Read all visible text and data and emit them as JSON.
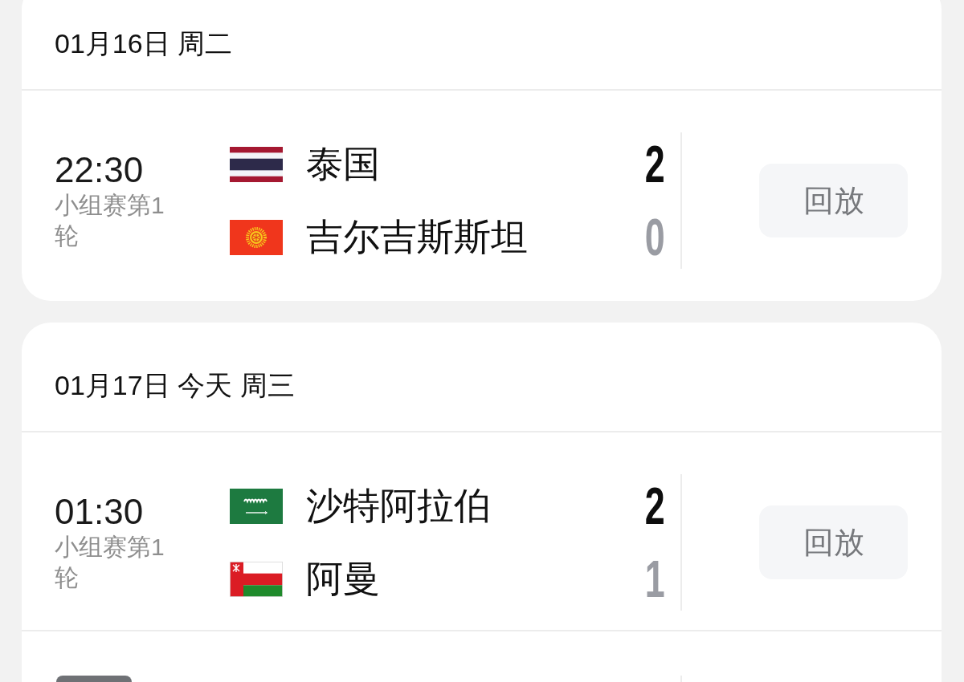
{
  "days": [
    {
      "date": "01月16日 周二",
      "matches": [
        {
          "kind": "result",
          "time": "22:30",
          "round": "小组赛第1轮",
          "teams": [
            {
              "kind": "thailand",
              "name": "泰国",
              "score": "2",
              "winner": true
            },
            {
              "kind": "kyrgyzstan",
              "name": "吉尔吉斯斯坦",
              "score": "0",
              "winner": false
            }
          ],
          "action": "回放"
        }
      ]
    },
    {
      "date": "01月17日 今天 周三",
      "matches": [
        {
          "kind": "result",
          "time": "01:30",
          "round": "小组赛第1轮",
          "teams": [
            {
              "kind": "saudi",
              "name": "沙特阿拉伯",
              "score": "2",
              "winner": true
            },
            {
              "kind": "oman",
              "name": "阿曼",
              "score": "1",
              "winner": false
            }
          ],
          "action": "回放"
        },
        {
          "kind": "cut"
        }
      ]
    }
  ]
}
